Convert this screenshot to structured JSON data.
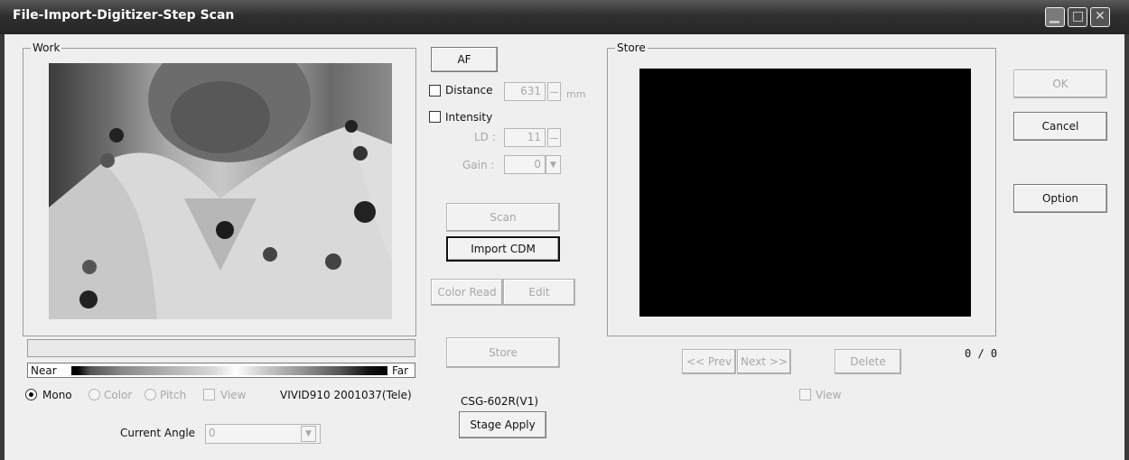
{
  "window": {
    "title": "File-Import-Digitizer-Step Scan"
  },
  "work": {
    "legend": "Work",
    "range": {
      "near": "Near",
      "far": "Far"
    },
    "modes": [
      {
        "label": "Mono",
        "checked": true,
        "enabled": true
      },
      {
        "label": "Color",
        "checked": false,
        "enabled": false
      },
      {
        "label": "Pitch",
        "checked": false,
        "enabled": false
      }
    ],
    "view_label": "View",
    "device_info": "VIVID910  2001037(Tele)",
    "current_angle_label": "Current Angle",
    "current_angle_value": "0"
  },
  "controls": {
    "af": "AF",
    "distance_label": "Distance",
    "distance_value": "631",
    "distance_unit": "mm",
    "intensity_label": "Intensity",
    "ld_label": "LD :",
    "ld_value": "11",
    "gain_label": "Gain :",
    "gain_value": "0",
    "scan": "Scan",
    "import_cdm": "Import CDM",
    "color_read": "Color Read",
    "edit": "Edit",
    "store": "Store",
    "stage_model": "CSG-602R(V1)",
    "stage_apply": "Stage Apply"
  },
  "store_panel": {
    "legend": "Store",
    "prev": "<< Prev",
    "next": "Next >>",
    "delete": "Delete",
    "count": "0 / 0",
    "view_label": "View"
  },
  "actions": {
    "ok": "OK",
    "cancel": "Cancel",
    "option": "Option"
  },
  "icons": {
    "minimize": "minimize-icon",
    "maximize": "maximize-icon",
    "close": "close-icon"
  }
}
